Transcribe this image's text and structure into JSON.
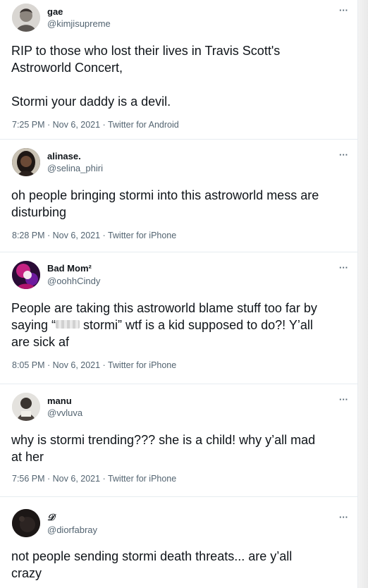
{
  "tweets": [
    {
      "name": "gae",
      "handle": "@kimjisupreme",
      "text": "RIP to those who lost their lives in Travis Scott's\nAstroworld Concert,\n\nStormi your daddy is a devil.",
      "meta": "7:25 PM · Nov 6, 2021 · Twitter for Android",
      "more": "···",
      "avatar_icon": "profile-photo"
    },
    {
      "name": "alinase.",
      "handle": "@selina_phiri",
      "text": "oh people bringing stormi into this astroworld mess are\ndisturbing",
      "meta": "8:28 PM · Nov 6, 2021 · Twitter for iPhone",
      "more": "···",
      "avatar_icon": "profile-photo"
    },
    {
      "name": "Bad Mom²",
      "handle": "@oohhCindy",
      "text_before": "People are taking this astroworld blame stuff too far by\nsaying “",
      "text_after": " stormi” wtf is a kid supposed to do?! Y’all\nare sick af",
      "meta": "8:05 PM · Nov 6, 2021 · Twitter for iPhone",
      "more": "···",
      "avatar_icon": "profile-photo"
    },
    {
      "name": "manu",
      "handle": "@vvluva",
      "text": "why is stormi trending??? she is a child! why y’all mad\nat her",
      "meta": "7:56 PM · Nov 6, 2021 · Twitter for iPhone",
      "more": "···",
      "avatar_icon": "profile-photo"
    },
    {
      "name": "𝒟",
      "handle": "@diorfabray",
      "text": "not people sending stormi death threats... are y’all\ncrazy",
      "more": "···",
      "avatar_icon": "profile-photo"
    }
  ],
  "colors": {
    "primary_text": "#0f1419",
    "secondary_text": "#536471",
    "divider": "#e6ecf0"
  }
}
